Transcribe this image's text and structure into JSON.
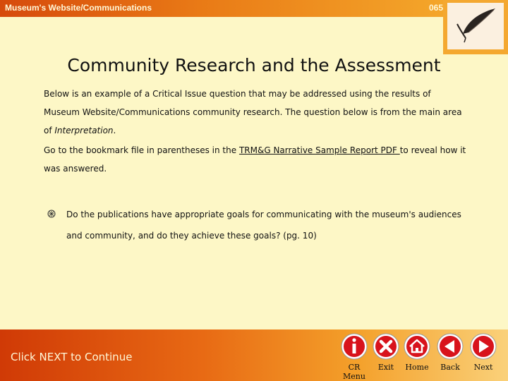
{
  "header": {
    "title": "Museum's Website/Communications",
    "slide_number": "065"
  },
  "title": "Community Research and the Assessment",
  "intro": {
    "line1": "Below is an example of a Critical Issue question that may be addressed using the results of Museum Website/Communications community research.  The question below is from the main area of ",
    "emphasis": "Interpretation",
    "line_end": "."
  },
  "instruction": {
    "before": "Go to the bookmark file in parentheses in the ",
    "link": "TRM&G Narrative Sample Report PDF ",
    "after": "to reveal how it was answered."
  },
  "bullet": {
    "text": "Do the publications have appropriate goals for communicating with the museum's audiences and community, and do they achieve these goals?  (pg. 10)"
  },
  "footer": {
    "prompt": "Click NEXT to Continue"
  },
  "nav": {
    "cr_label": "CR",
    "menu_label": "Menu",
    "exit_label": "Exit",
    "home_label": "Home",
    "back_label": "Back",
    "next_label": "Next"
  },
  "colors": {
    "header_start": "#d64a0c",
    "header_end": "#f4a62a",
    "background": "#fdf7c6",
    "button_red": "#d8131c"
  }
}
